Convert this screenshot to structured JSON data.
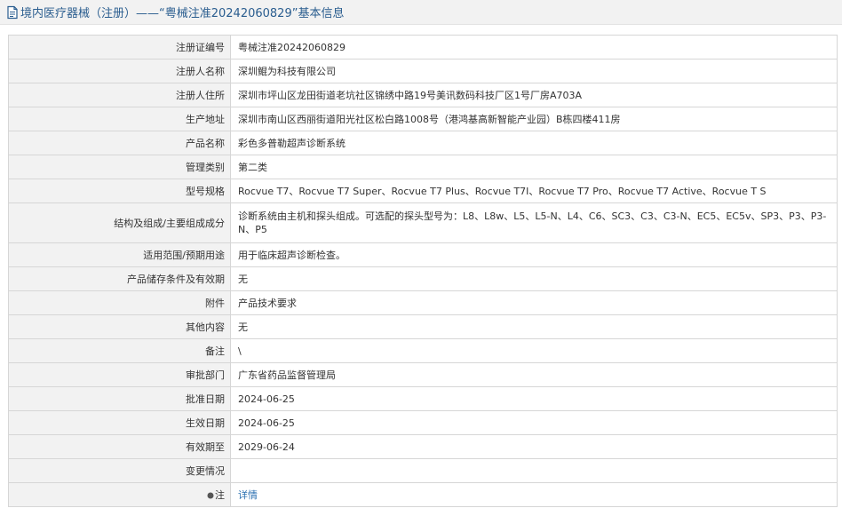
{
  "header": {
    "title": "境内医疗器械（注册）——“粤械注准20242060829”基本信息",
    "icon": "document-icon"
  },
  "rows": [
    {
      "key": "reg_no",
      "label": "注册证编号",
      "value": "粤械注准20242060829"
    },
    {
      "key": "registrant",
      "label": "注册人名称",
      "value": "深圳鲲为科技有限公司"
    },
    {
      "key": "registrant_address",
      "label": "注册人住所",
      "value": "深圳市坪山区龙田街道老坑社区锦绣中路19号美讯数码科技厂区1号厂房A703A"
    },
    {
      "key": "production_address",
      "label": "生产地址",
      "value": "深圳市南山区西丽街道阳光社区松白路1008号（港鸿基高新智能产业园）B栋四楼411房"
    },
    {
      "key": "product_name",
      "label": "产品名称",
      "value": "彩色多普勒超声诊断系统"
    },
    {
      "key": "category",
      "label": "管理类别",
      "value": "第二类"
    },
    {
      "key": "model",
      "label": "型号规格",
      "value": "Rocvue T7、Rocvue T7 Super、Rocvue T7 Plus、Rocvue T7I、Rocvue T7 Pro、Rocvue T7 Active、Rocvue T S"
    },
    {
      "key": "composition",
      "label": "结构及组成/主要组成成分",
      "value": "诊断系统由主机和探头组成。可选配的探头型号为：L8、L8w、L5、L5-N、L4、C6、SC3、C3、C3-N、EC5、EC5v、SP3、P3、P3-N、P5"
    },
    {
      "key": "scope",
      "label": "适用范围/预期用途",
      "value": "用于临床超声诊断检查。"
    },
    {
      "key": "storage",
      "label": "产品储存条件及有效期",
      "value": "无"
    },
    {
      "key": "attachment",
      "label": "附件",
      "value": "产品技术要求"
    },
    {
      "key": "other",
      "label": "其他内容",
      "value": "无"
    },
    {
      "key": "remark",
      "label": "备注",
      "value": "\\"
    },
    {
      "key": "dept",
      "label": "审批部门",
      "value": "广东省药品监督管理局"
    },
    {
      "key": "approve_date",
      "label": "批准日期",
      "value": "2024-06-25"
    },
    {
      "key": "effective_date",
      "label": "生效日期",
      "value": "2024-06-25"
    },
    {
      "key": "expiry_date",
      "label": "有效期至",
      "value": "2029-06-24"
    },
    {
      "key": "changes",
      "label": "变更情况",
      "value": ""
    }
  ],
  "note": {
    "label": "注",
    "icon": "bullet-icon",
    "link": "详情"
  }
}
